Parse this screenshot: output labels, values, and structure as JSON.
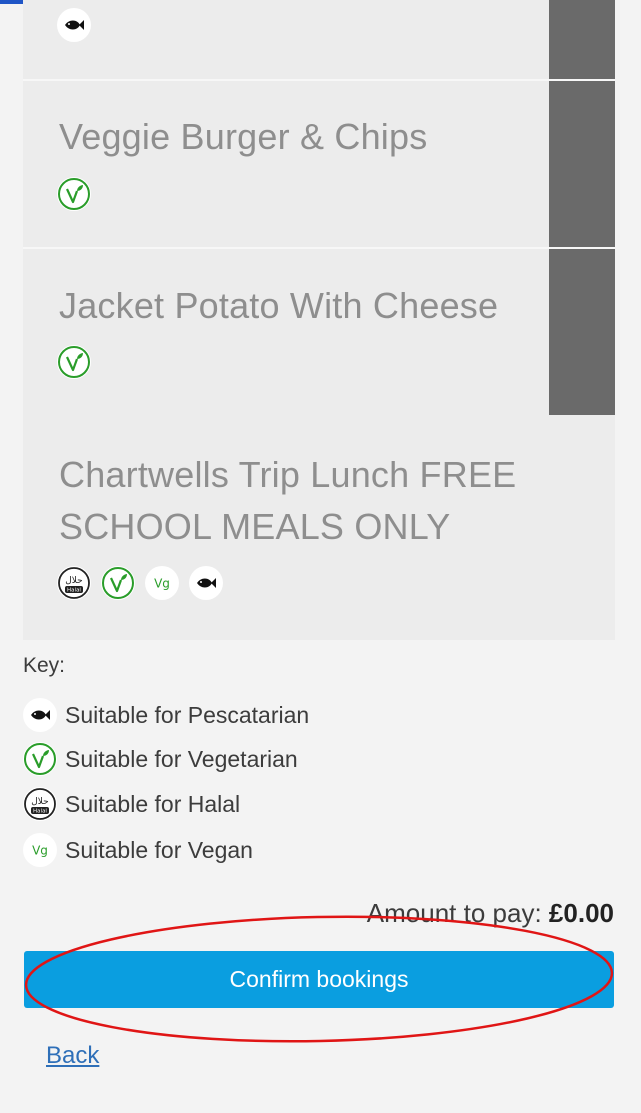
{
  "menu": {
    "items": [
      {
        "title": "",
        "icons": [
          "fish-icon"
        ]
      },
      {
        "title": "Veggie Burger & Chips",
        "icons": [
          "vegetarian-icon"
        ]
      },
      {
        "title": "Jacket Potato With Cheese",
        "icons": [
          "vegetarian-icon"
        ]
      },
      {
        "title_line1": "Chartwells Trip Lunch FREE",
        "title_line2": "SCHOOL MEALS ONLY",
        "icons": [
          "halal-icon",
          "vegetarian-icon",
          "vegan-icon",
          "fish-icon"
        ]
      }
    ]
  },
  "key": {
    "title": "Key:",
    "items": [
      {
        "icon": "fish-icon",
        "label": "Suitable for Pescatarian"
      },
      {
        "icon": "vegetarian-icon",
        "label": "Suitable for Vegetarian"
      },
      {
        "icon": "halal-icon",
        "label": "Suitable for Halal"
      },
      {
        "icon": "vegan-icon",
        "label": "Suitable for Vegan"
      }
    ]
  },
  "payment": {
    "label": "Amount to pay:",
    "amount": "£0.00"
  },
  "actions": {
    "confirm_label": "Confirm bookings",
    "back_label": "Back"
  },
  "icon_text": {
    "vegan": "Vg",
    "halal_top": "حلال",
    "halal_bottom": "Halal"
  },
  "colors": {
    "accent_blue": "#0a9ee0",
    "veg_green": "#2a9d2a",
    "annotation_red": "#e01515",
    "link": "#2e6fb8"
  }
}
